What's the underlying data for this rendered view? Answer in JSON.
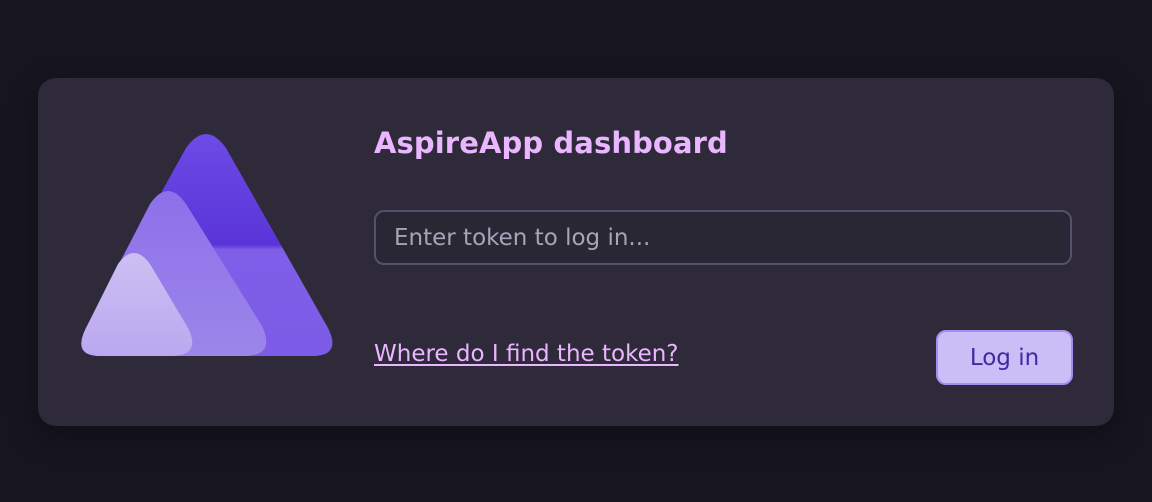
{
  "app": {
    "title": "AspireApp dashboard",
    "logo_icon": "aspire-logo-icon"
  },
  "login": {
    "token_placeholder": "Enter token to log in...",
    "token_value": "",
    "help_link_label": "Where do I find the token?",
    "login_button_label": "Log in"
  },
  "colors": {
    "page_background": "#17151f",
    "card_background": "#2e2a3a",
    "title": "#eab6ff",
    "link": "#eab6ff",
    "button_background": "#cbbdf6",
    "button_text": "#3d2ba3",
    "input_border": "#55516a"
  }
}
